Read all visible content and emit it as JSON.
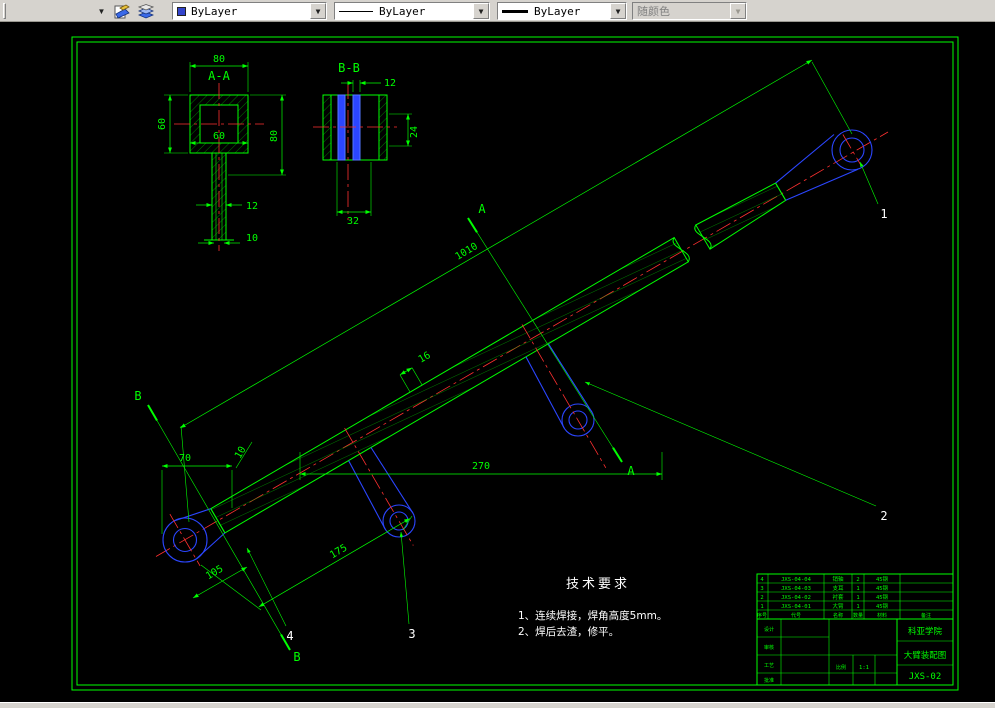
{
  "toolbar": {
    "chevron": "▼",
    "color_value": "ByLayer",
    "linetype_value": "ByLayer",
    "lineweight_value": "ByLayer",
    "plotstyle_value": "随颜色"
  },
  "colors": {
    "line_green": "#00ff00",
    "center_red": "#ff3030",
    "detail_blue": "#2b46ff",
    "swatch_blue": "#3344cc"
  },
  "drawing": {
    "sections": {
      "aa": "A-A",
      "bb": "B-B",
      "a": "A",
      "b": "B"
    },
    "dims": {
      "aa_top": "80",
      "aa_left": "60",
      "aa_right": "80",
      "aa_inner": "60",
      "aa_stem_w": "12",
      "aa_stem_i": "10",
      "bb_w": "12",
      "bb_h": "24",
      "bb_total": "32",
      "arm_len": "1010",
      "d70": "70",
      "d10": "10",
      "d16": "16",
      "d270": "270",
      "d175": "175",
      "d105": "105"
    },
    "balloons": {
      "b1": "1",
      "b2": "2",
      "b3": "3",
      "b4": "4"
    },
    "tech": {
      "title": "技术要求",
      "line1": "1、连续焊接，焊角高度5mm。",
      "line2": "2、焊后去渣，修平。"
    },
    "title_block": {
      "parts": [
        {
          "no": "4",
          "code": "JXS-04-04",
          "name": "销轴",
          "qty": "2",
          "material": "45钢"
        },
        {
          "no": "3",
          "code": "JXS-04-03",
          "name": "支耳",
          "qty": "1",
          "material": "45钢"
        },
        {
          "no": "2",
          "code": "JXS-04-02",
          "name": "衬套",
          "qty": "1",
          "material": "45钢"
        },
        {
          "no": "1",
          "code": "JXS-04-01",
          "name": "大臂",
          "qty": "1",
          "material": "45钢"
        }
      ],
      "header": {
        "no": "序号",
        "code": "代号",
        "name": "名称",
        "qty": "数量",
        "material": "材料",
        "note": "备注"
      },
      "sig_labels": {
        "design": "设计",
        "audit": "审核",
        "process": "工艺",
        "approve": "批准"
      },
      "scale_label": "比例",
      "scale": "1:1",
      "company": "科亚学院",
      "drawing_title": "大臂装配图",
      "drawing_no": "JXS-02"
    }
  }
}
